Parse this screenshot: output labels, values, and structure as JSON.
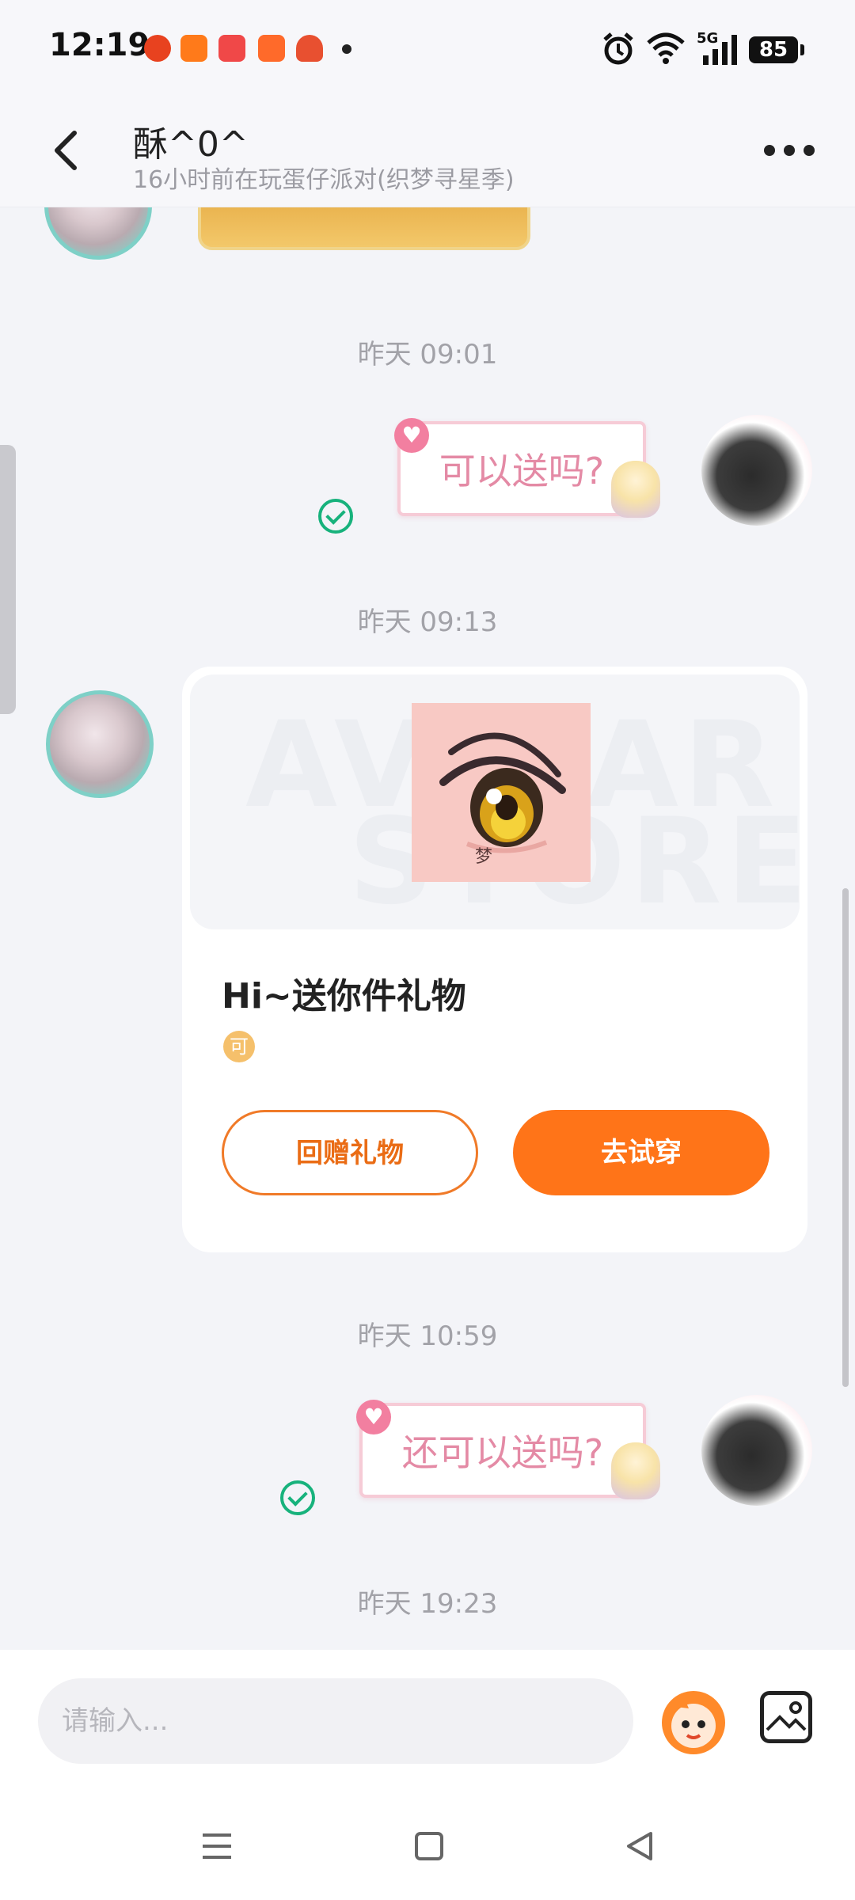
{
  "status_bar": {
    "time": "12:19",
    "battery": "85",
    "network": "5G"
  },
  "header": {
    "title": "酥^0^",
    "subtitle": "16小时前在玩蛋仔派对(织梦寻星季)"
  },
  "messages": [
    {
      "timestamp": "昨天 09:01",
      "sticker_text": "可以送吗?"
    },
    {
      "timestamp": "昨天 09:13"
    },
    {
      "timestamp": "昨天 10:59",
      "sticker_text": "还可以送吗?"
    },
    {
      "timestamp": "昨天 19:23"
    }
  ],
  "gift_card": {
    "title": "Hi~送你件礼物",
    "coin_label": "可",
    "gift_glyph": "梦",
    "watermark_top": "AVATAR",
    "watermark_bottom": "STORE",
    "return_gift_label": "回赠礼物",
    "try_on_label": "去试穿"
  },
  "input": {
    "placeholder": "请输入..."
  },
  "colors": {
    "accent": "#ff7418",
    "read_check": "#17b27c",
    "sticker_text": "#e48aa5"
  },
  "icons": {
    "back": "chevron-left-icon",
    "more": "more-dots-icon",
    "emoji": "eggy-emoji-icon",
    "image": "image-icon"
  }
}
